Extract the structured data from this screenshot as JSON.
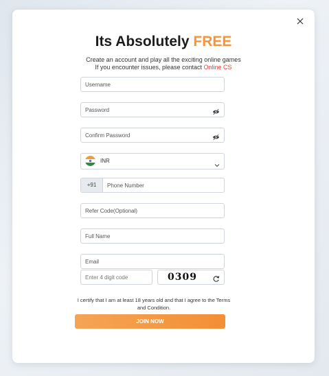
{
  "title": {
    "main": "Its Absolutely",
    "highlight": "FREE"
  },
  "subtitle": {
    "line1": "Create an account and play all the exciting online games",
    "line2_prefix": "If you encounter issues, please contact",
    "line2_link": "Online CS"
  },
  "form": {
    "username_placeholder": "Username",
    "password_placeholder": "Password",
    "confirm_password_placeholder": "Confirm Password",
    "currency": {
      "value": "INR",
      "flag": "india-flag"
    },
    "phone": {
      "prefix": "+91",
      "placeholder": "Phone Number"
    },
    "refer_code_placeholder": "Refer Code(Optional)",
    "full_name_placeholder": "Full Name",
    "email_placeholder": "Email",
    "captcha": {
      "placeholder": "Enter 4 digit code",
      "code": "0309"
    }
  },
  "certify_text": "I certify that I am at least 18 years old and that I agree to the Terms and Condition.",
  "join_label": "JOIN NOW",
  "colors": {
    "accent": "#f5953b",
    "link": "#e0453a"
  },
  "icons": {
    "close": "close-icon",
    "eye": "eye-off-icon",
    "refresh": "refresh-icon",
    "chevron": "chevron-down-icon"
  }
}
